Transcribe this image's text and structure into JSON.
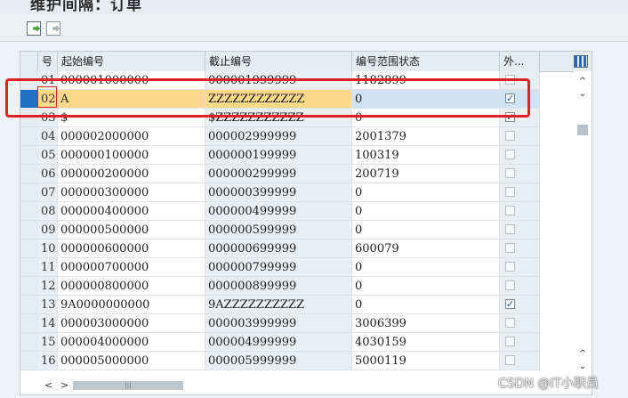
{
  "window": {
    "title": "维护间隔：订单"
  },
  "grid": {
    "columns": [
      "号",
      "起始编号",
      "截止编号",
      "编号范围状态",
      "外..."
    ],
    "rows": [
      {
        "no": "01",
        "start": "000001000000",
        "end": "000001999999",
        "status": "1182899",
        "ext": false
      },
      {
        "no": "02",
        "start": "A",
        "end": "ZZZZZZZZZZZZ",
        "status": "0",
        "ext": true
      },
      {
        "no": "03",
        "start": "$",
        "end": "$ZZZZZZZZZZZ",
        "status": "0",
        "ext": true
      },
      {
        "no": "04",
        "start": "000002000000",
        "end": "000002999999",
        "status": "2001379",
        "ext": false
      },
      {
        "no": "05",
        "start": "000000100000",
        "end": "000000199999",
        "status": "100319",
        "ext": false
      },
      {
        "no": "06",
        "start": "000000200000",
        "end": "000000299999",
        "status": "200719",
        "ext": false
      },
      {
        "no": "07",
        "start": "000000300000",
        "end": "000000399999",
        "status": "0",
        "ext": false
      },
      {
        "no": "08",
        "start": "000000400000",
        "end": "000000499999",
        "status": "0",
        "ext": false
      },
      {
        "no": "09",
        "start": "000000500000",
        "end": "000000599999",
        "status": "0",
        "ext": false
      },
      {
        "no": "10",
        "start": "000000600000",
        "end": "000000699999",
        "status": "600079",
        "ext": false
      },
      {
        "no": "11",
        "start": "000000700000",
        "end": "000000799999",
        "status": "0",
        "ext": false
      },
      {
        "no": "12",
        "start": "000000800000",
        "end": "000000899999",
        "status": "0",
        "ext": false
      },
      {
        "no": "13",
        "start": "9A0000000000",
        "end": "9AZZZZZZZZZZ",
        "status": "0",
        "ext": true
      },
      {
        "no": "14",
        "start": "000003000000",
        "end": "000003999999",
        "status": "3006399",
        "ext": false
      },
      {
        "no": "15",
        "start": "000004000000",
        "end": "000004999999",
        "status": "4030159",
        "ext": false
      },
      {
        "no": "16",
        "start": "000005000000",
        "end": "000005999999",
        "status": "5000119",
        "ext": false
      }
    ],
    "selected_row": "02"
  },
  "watermark": "CSDN @IT小职员",
  "colors": {
    "selected_row_bg": "#fbd98a",
    "selected_status_bg": "#cfe3f4",
    "selector_active": "#1f6fc5",
    "highlight_box": "#e32020"
  },
  "icons": [
    "export-icon",
    "import-icon",
    "layout-icon",
    "scroll-up-icon",
    "scroll-down-icon",
    "scroll-left-icon",
    "scroll-right-icon"
  ]
}
